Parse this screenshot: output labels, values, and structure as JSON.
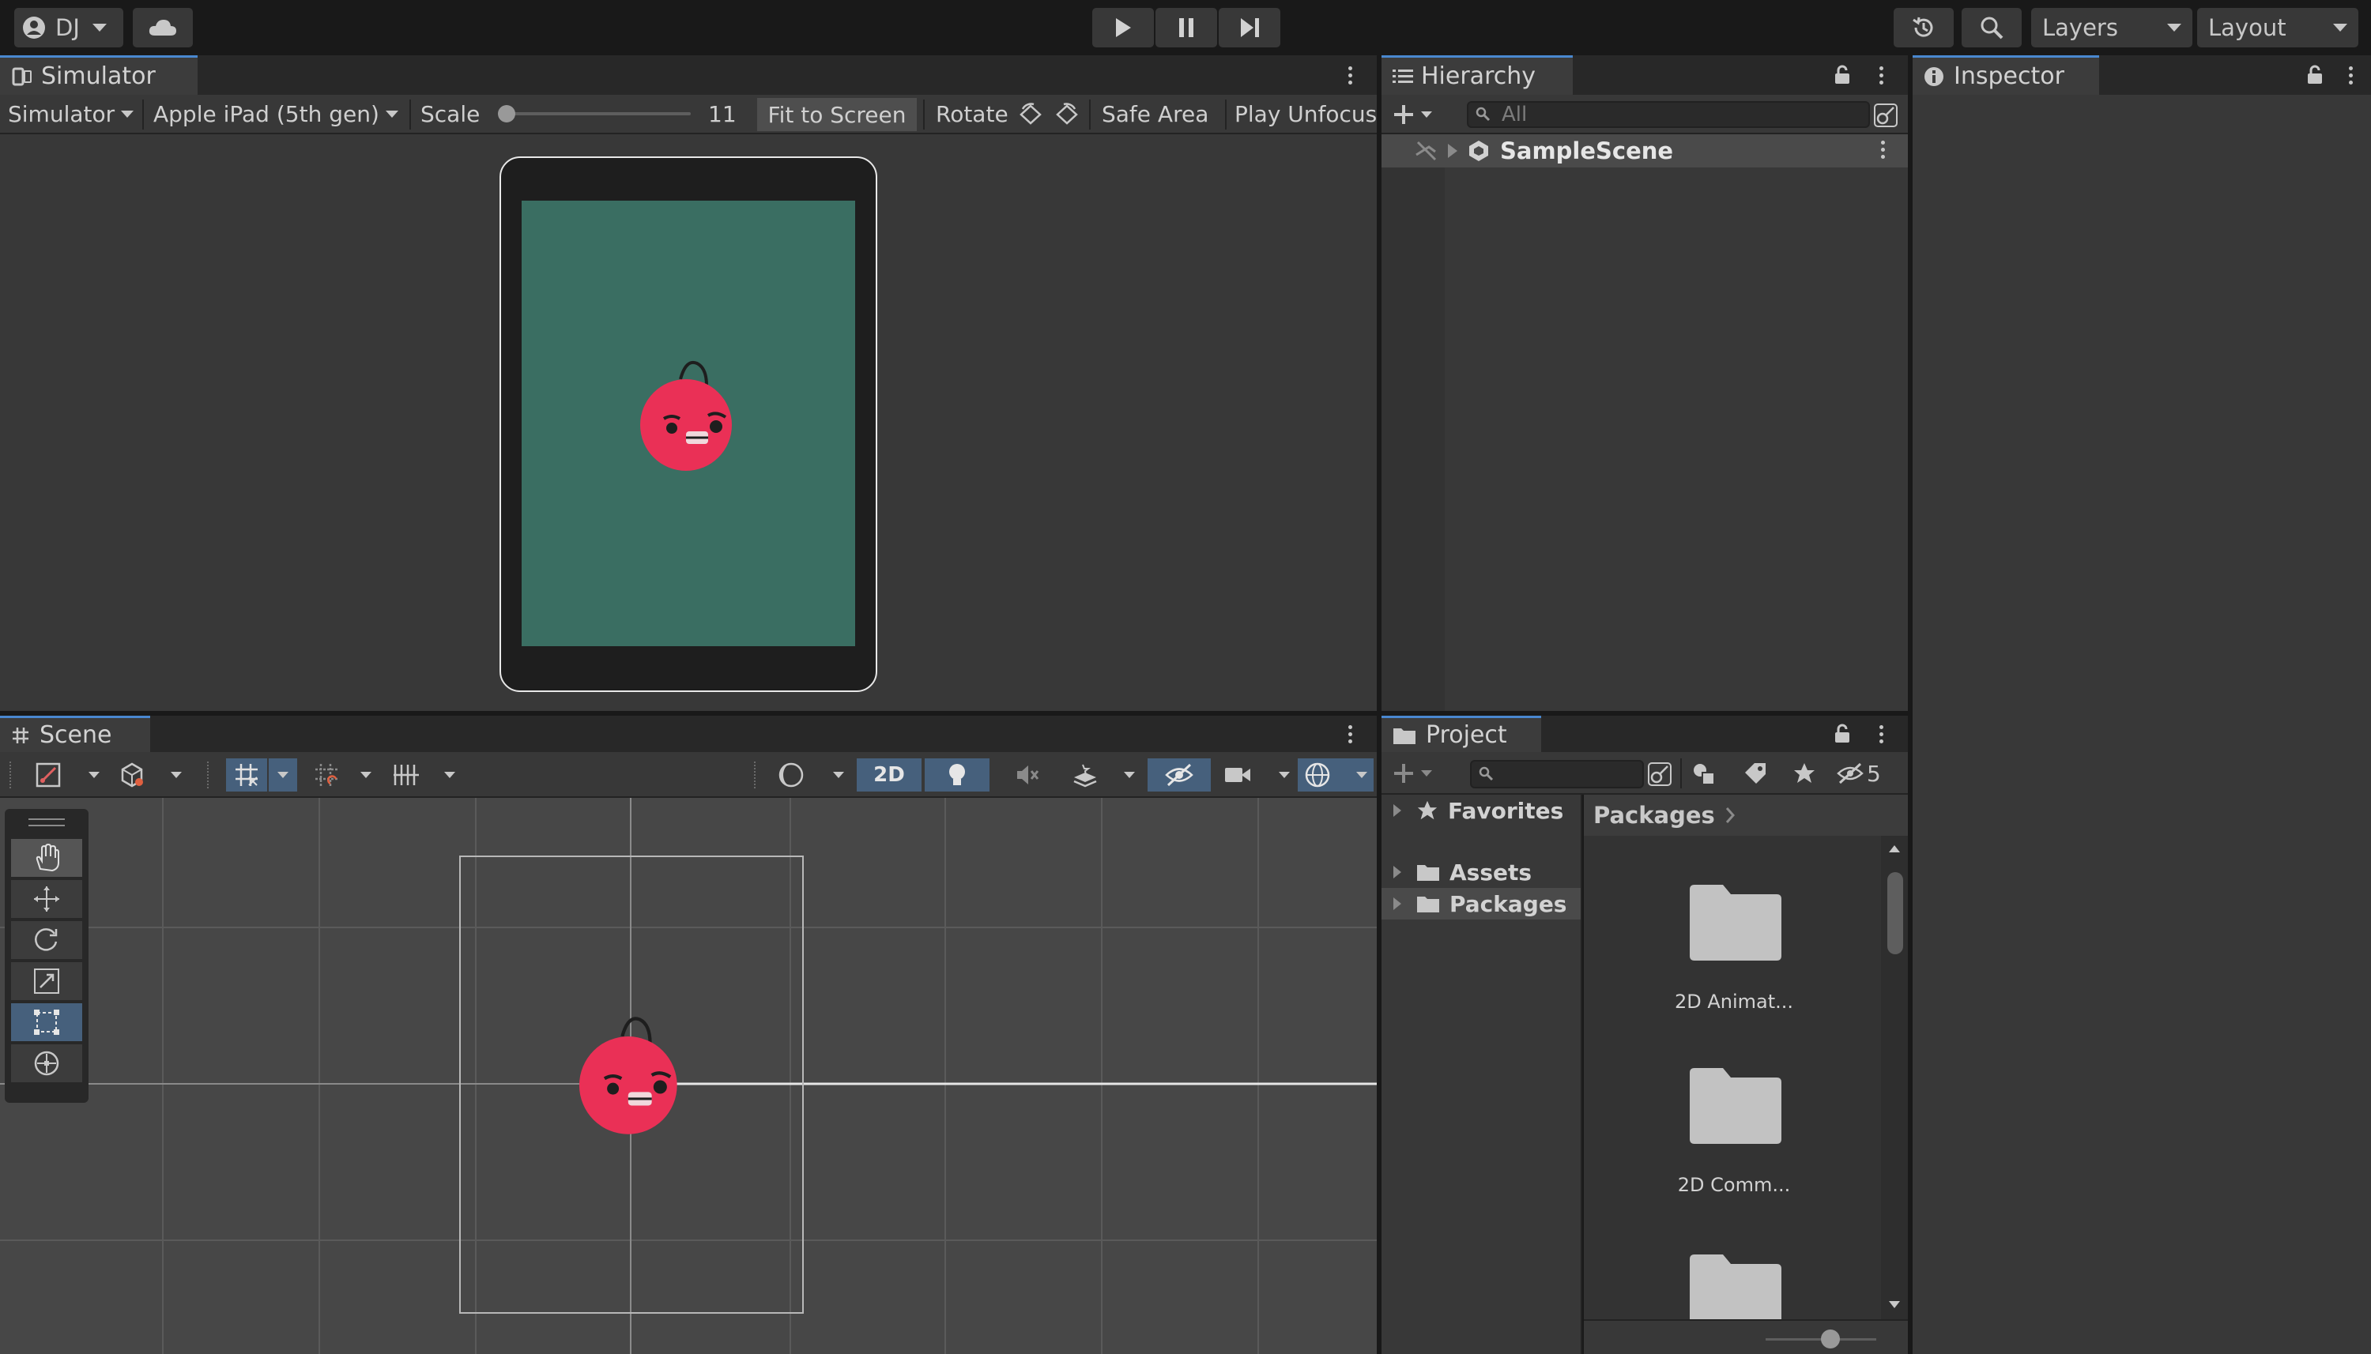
{
  "topbar": {
    "account_label": "DJ",
    "layers_label": "Layers",
    "layout_label": "Layout",
    "icons": [
      "account-icon",
      "cloud-icon",
      "play-icon",
      "pause-icon",
      "step-icon",
      "history-icon",
      "search-icon"
    ]
  },
  "simulator": {
    "tab_label": "Simulator",
    "mode_label": "Simulator",
    "device_label": "Apple iPad (5th gen)",
    "scale_label": "Scale",
    "scale_value": "11",
    "fit_label": "Fit to Screen",
    "rotate_label": "Rotate",
    "safe_area_label": "Safe Area",
    "play_unfocused_label": "Play Unfocuse",
    "screen_color": "#3a6e62"
  },
  "hierarchy": {
    "tab_label": "Hierarchy",
    "search_placeholder": "All",
    "scene_name": "SampleScene"
  },
  "inspector": {
    "tab_label": "Inspector"
  },
  "scene": {
    "tab_label": "Scene",
    "mode_2d_label": "2D",
    "tools": [
      "hand-tool",
      "move-tool",
      "rotate-tool",
      "scale-tool",
      "rect-tool",
      "transform-tool"
    ],
    "active_tool": "rect-tool"
  },
  "project": {
    "tab_label": "Project",
    "hidden_count": "5",
    "tree": {
      "favorites": "Favorites",
      "assets": "Assets",
      "packages": "Packages"
    },
    "breadcrumb": "Packages",
    "folders": [
      {
        "name": "2D Animat..."
      },
      {
        "name": "2D Comm..."
      },
      {
        "name": ""
      }
    ]
  },
  "colors": {
    "accent": "#4a88d0",
    "active_button": "#46607c",
    "bird": "#ea3056"
  }
}
